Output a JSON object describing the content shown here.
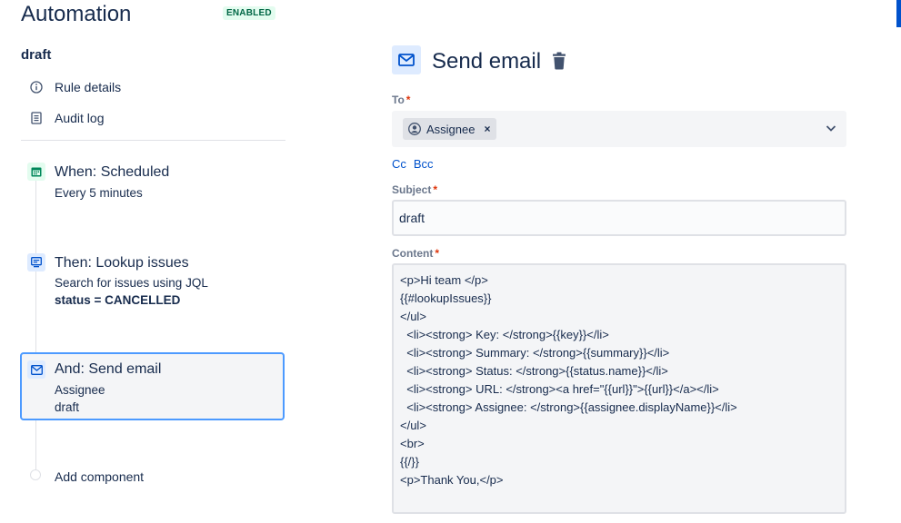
{
  "header": {
    "title": "Automation",
    "status_badge": "ENABLED"
  },
  "rule": {
    "name": "draft"
  },
  "nav": [
    {
      "label": "Rule details",
      "icon": "info-icon"
    },
    {
      "label": "Audit log",
      "icon": "document-icon"
    }
  ],
  "steps": {
    "when": {
      "title": "When: Scheduled",
      "sub": "Every 5 minutes",
      "icon": "calendar-icon"
    },
    "then": {
      "title": "Then: Lookup issues",
      "sub": "Search for issues using JQL",
      "detail": "status = CANCELLED",
      "icon": "monitor-icon"
    },
    "and": {
      "title": "And: Send email",
      "sub1": "Assignee",
      "sub2": "draft",
      "icon": "mail-icon"
    },
    "add": {
      "label": "Add component"
    }
  },
  "action": {
    "title": "Send email",
    "to": {
      "label": "To",
      "required": "*",
      "chip": "Assignee"
    },
    "cc": "Cc",
    "bcc": "Bcc",
    "subject": {
      "label": "Subject",
      "required": "*",
      "value": "draft"
    },
    "content": {
      "label": "Content",
      "required": "*",
      "lines": [
        "<p>Hi team </p>",
        "{{#lookupIssues}}",
        "</ul>",
        "  <li><strong> Key: </strong>{{key}}</li>",
        "  <li><strong> Summary: </strong>{{summary}}</li>",
        "  <li><strong> Status: </strong>{{status.name}}</li>",
        "  <li><strong> URL: </strong><a href=\"{{url}}\">{{url}}</a></li>",
        "  <li><strong> Assignee: </strong>{{assignee.displayName}}</li>",
        "</ul>",
        "<br>",
        "{{/}}",
        "<p>Thank You,</p>"
      ]
    }
  },
  "colors": {
    "accent": "#0052cc",
    "enabled_bg": "#e3fcef",
    "enabled_text": "#006644",
    "selected_border": "#4c9aff"
  }
}
